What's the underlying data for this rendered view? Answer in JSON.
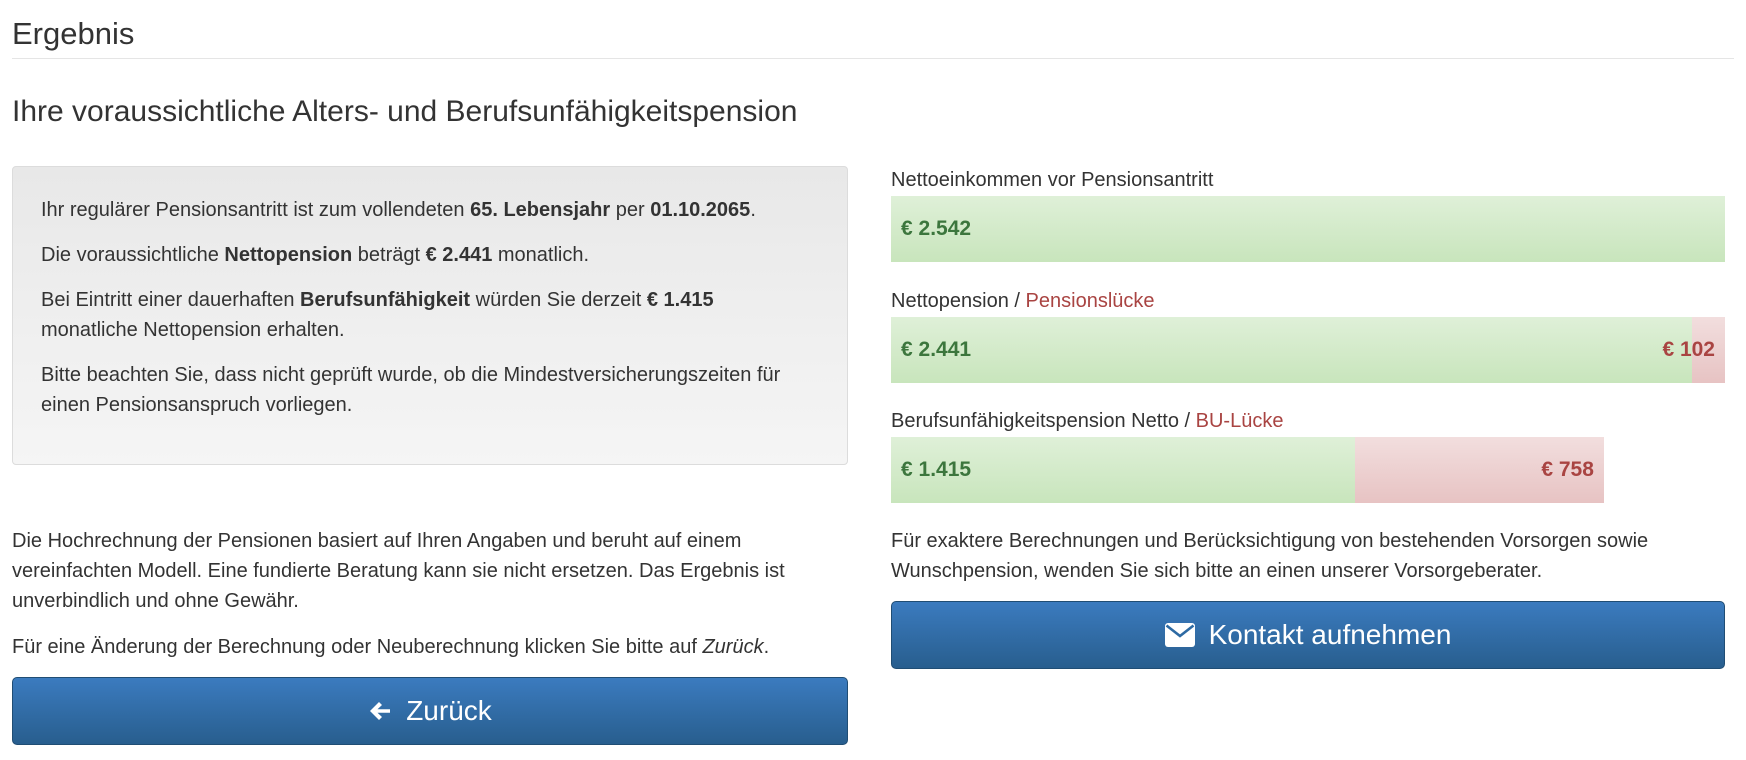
{
  "header": {
    "title": "Ergebnis",
    "subtitle": "Ihre voraussichtliche Alters- und Berufsunfähigkeitspension"
  },
  "info": {
    "p1": {
      "pre": "Ihr regulärer Pensionsantritt ist zum vollendeten ",
      "b1": "65. Lebensjahr",
      "mid": " per ",
      "b2": "01.10.2065",
      "post": "."
    },
    "p2": {
      "pre": "Die voraussichtliche ",
      "b1": "Nettopension",
      "mid": " beträgt ",
      "b2": "€ 2.441",
      "post": " monatlich."
    },
    "p3": {
      "pre": "Bei Eintritt einer dauerhaften ",
      "b1": "Berufsunfähigkeit",
      "mid": " würden Sie derzeit ",
      "b2": "€ 1.415",
      "post": " monatliche Nettopension erhalten."
    },
    "p4": "Bitte beachten Sie, dass nicht geprüft wurde, ob die Mindestversicherungszeiten für einen Pensionsanspruch vorliegen."
  },
  "disclaimer": "Die Hochrechnung der Pensionen basiert auf Ihren Angaben und beruht auf einem vereinfachten Modell. Eine fundierte Beratung kann sie nicht ersetzen. Das Ergebnis ist unverbindlich und ohne Gewähr.",
  "change_note": {
    "pre": "Für eine Änderung der Berechnung oder Neuberechnung klicken Sie bitte auf ",
    "link": "Zurück",
    "post": "."
  },
  "back_button": {
    "label": "Zurück",
    "icon": "arrow-left-icon"
  },
  "bars": {
    "income": {
      "label": "Nettoeinkommen vor Pensionsantritt",
      "value_label": "€ 2.542",
      "value": 2542
    },
    "pension": {
      "label": "Nettopension",
      "separator": " / ",
      "gap_label": "Pensionslücke",
      "value_label": "€ 2.441",
      "value": 2441,
      "gap_value_label": "€ 102",
      "gap_value": 102
    },
    "bu": {
      "label": "Berufsunfähigkeitspension Netto",
      "separator": " / ",
      "gap_label": "BU-Lücke",
      "value_label": "€ 1.415",
      "value": 1415,
      "gap_value_label": "€ 758",
      "gap_value": 758
    }
  },
  "contact_note": "Für exaktere Berechnungen und Berücksichtigung von bestehenden Vorsorgen sowie Wunschpension, wenden Sie sich bitte an einen unserer Vorsorgeberater.",
  "contact_button": {
    "label": "Kontakt aufnehmen",
    "icon": "envelope-icon"
  },
  "colors": {
    "primary_button": "#337ab7",
    "success_text": "#3c763d",
    "danger_text": "#a94442",
    "success_bg": "#dff0d8",
    "danger_bg": "#f2dede"
  }
}
